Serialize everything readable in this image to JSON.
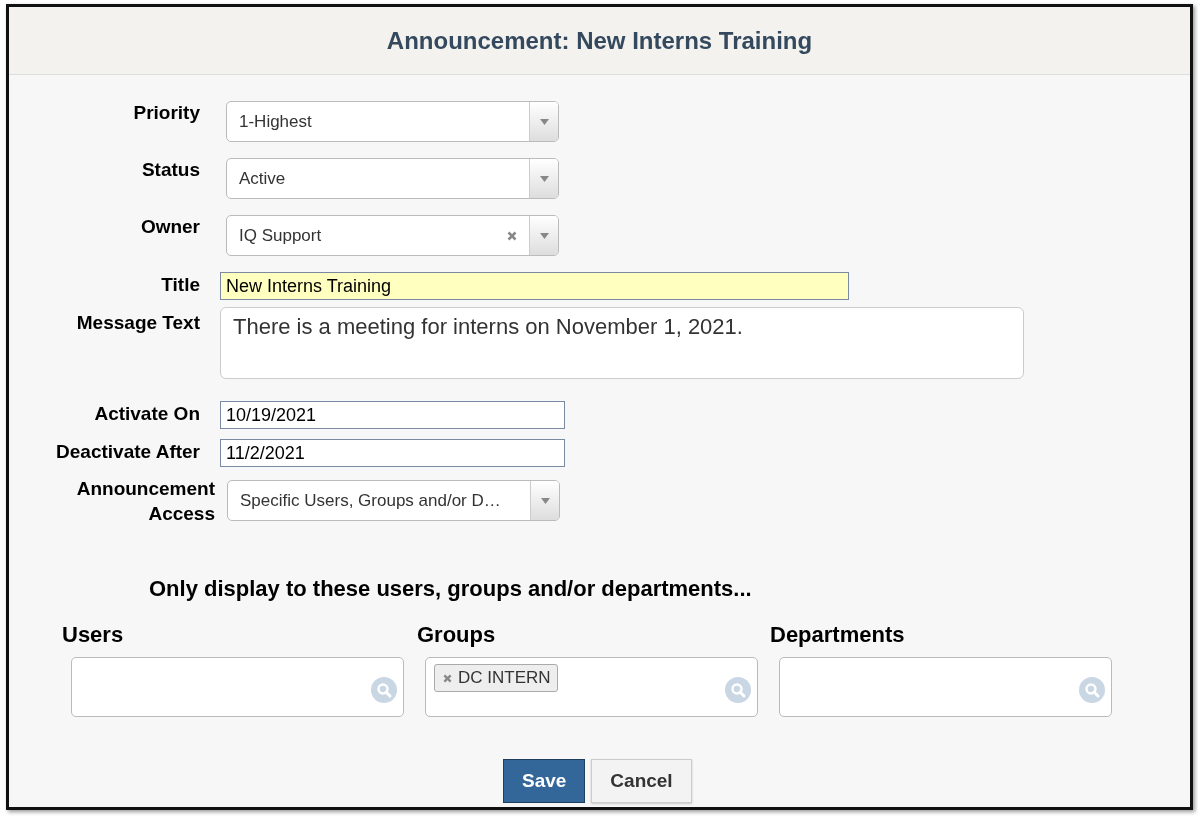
{
  "dialog": {
    "title": "Announcement: New Interns Training"
  },
  "fields": [
    {
      "kind": "select",
      "label": "Priority",
      "value": "1-Highest",
      "clearable": false
    },
    {
      "kind": "select",
      "label": "Status",
      "value": "Active",
      "clearable": false
    },
    {
      "kind": "select",
      "label": "Owner",
      "value": "IQ Support",
      "clearable": true
    },
    {
      "kind": "text",
      "label": "Title",
      "value": "New Interns Training",
      "highlighted": true
    },
    {
      "kind": "textarea",
      "label": "Message Text",
      "value": "There is a meeting for interns on November 1, 2021."
    },
    {
      "kind": "text",
      "label": "Activate On",
      "value": "10/19/2021",
      "highlighted": false
    },
    {
      "kind": "text",
      "label": "Deactivate After",
      "value": "11/2/2021",
      "highlighted": false
    },
    {
      "kind": "select",
      "label": "Announcement Access",
      "value": "Specific Users, Groups and/or D…",
      "clearable": false
    }
  ],
  "audience": {
    "heading": "Only display to these users, groups and/or departments...",
    "pickers": [
      {
        "label": "Users"
      },
      {
        "label": "Groups",
        "tags": [
          "DC INTERN"
        ]
      },
      {
        "label": "Departments"
      }
    ]
  },
  "buttons": [
    {
      "label": "Save",
      "kind": "primary"
    },
    {
      "label": "Cancel",
      "kind": "secondary"
    }
  ]
}
